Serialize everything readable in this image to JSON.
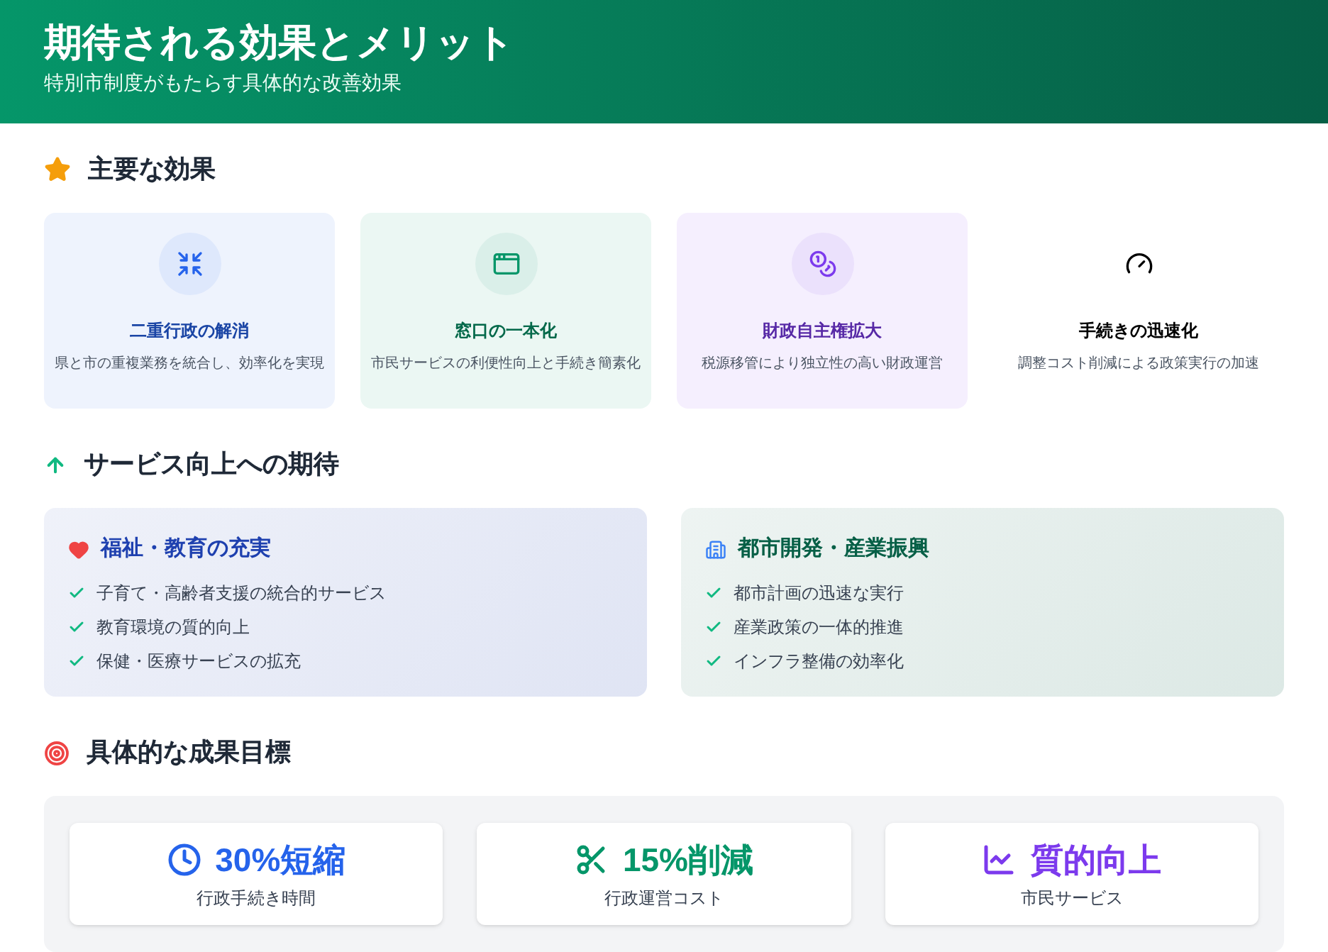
{
  "header": {
    "title": "期待される効果とメリット",
    "subtitle": "特別市制度がもたらす具体的な改善効果"
  },
  "main_effects": {
    "heading": "主要な効果",
    "cards": [
      {
        "kind": "merge",
        "color": "#2563eb",
        "title": "二重行政の解消",
        "description": "県と市の重複業務を統合し、効率化を実現"
      },
      {
        "kind": "window",
        "color": "#059669",
        "title": "窓口の一本化",
        "description": "市民サービスの利便性向上と手続き簡素化"
      },
      {
        "kind": "coins",
        "color": "#7c3aed",
        "title": "財政自主権拡大",
        "description": "税源移管により独立性の高い財政運営"
      },
      {
        "kind": "gauge",
        "title": "手続きの迅速化",
        "description": "調整コスト削減による政策実行の加速"
      }
    ]
  },
  "service": {
    "heading": "サービス向上への期待",
    "panels": [
      {
        "kind": "heart",
        "color": "#1e40af",
        "title": "福祉・教育の充実",
        "items": [
          "子育て・高齢者支援の統合的サービス",
          "教育環境の質的向上",
          "保健・医療サービスの拡充"
        ]
      },
      {
        "kind": "building",
        "color": "#065f46",
        "title": "都市開発・産業振興",
        "items": [
          "都市計画の迅速な実行",
          "産業政策の一体的推進",
          "インフラ整備の効率化"
        ]
      }
    ]
  },
  "targets": {
    "heading": "具体的な成果目標",
    "cards": [
      {
        "kind": "clock",
        "color": "#2563eb",
        "value": "30%短縮",
        "label": "行政手続き時間"
      },
      {
        "kind": "scissors",
        "color": "#059669",
        "value": "15%削減",
        "label": "行政運営コスト"
      },
      {
        "kind": "chart",
        "color": "#7c3aed",
        "value": "質的向上",
        "label": "市民サービス"
      }
    ]
  }
}
